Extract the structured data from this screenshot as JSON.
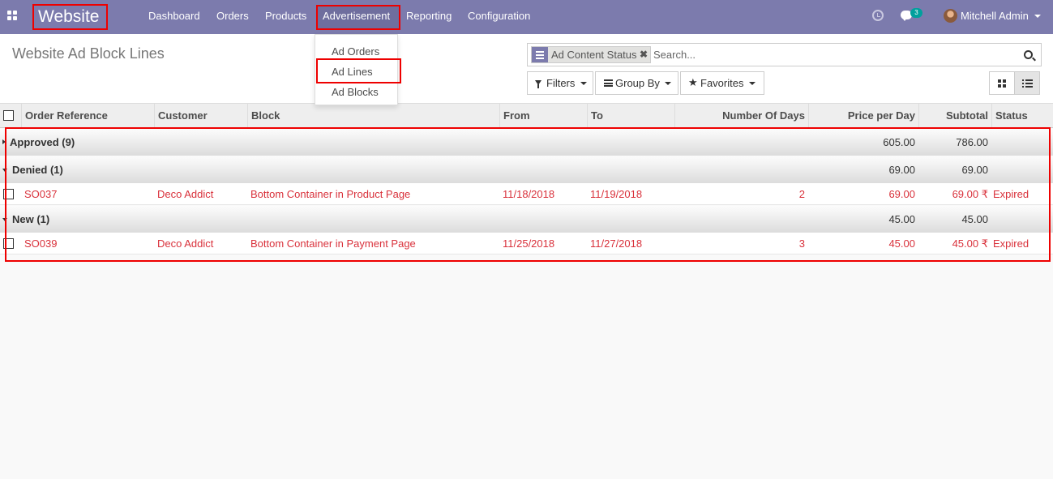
{
  "navbar": {
    "brand": "Website",
    "menu": [
      "Dashboard",
      "Orders",
      "Products",
      "Advertisement",
      "Reporting",
      "Configuration"
    ],
    "chat_count": "3",
    "user": "Mitchell Admin",
    "bg_color": "#7c7bad"
  },
  "advertisement_menu": {
    "items": [
      "Ad Orders",
      "Ad Lines",
      "Ad Blocks"
    ],
    "highlighted": "Ad Lines"
  },
  "control_panel": {
    "title": "Website Ad Block Lines",
    "search": {
      "facet": "Ad Content Status",
      "placeholder": "Search..."
    },
    "buttons": {
      "filters": "Filters",
      "group_by": "Group By",
      "favorites": "Favorites"
    },
    "active_view": "list"
  },
  "table": {
    "columns": [
      "Order Reference",
      "Customer",
      "Block",
      "From",
      "To",
      "Number Of Days",
      "Price per Day",
      "Subtotal",
      "Status"
    ],
    "groups": [
      {
        "label": "Approved (9)",
        "expanded": false,
        "price_per_day": "605.00",
        "subtotal": "786.00",
        "rows": []
      },
      {
        "label": "Denied (1)",
        "expanded": true,
        "price_per_day": "69.00",
        "subtotal": "69.00",
        "rows": [
          {
            "order_ref": "SO037",
            "customer": "Deco Addict",
            "block": "Bottom Container in Product Page",
            "from": "11/18/2018",
            "to": "11/19/2018",
            "days": "2",
            "price_per_day": "69.00",
            "subtotal": "69.00 ₹",
            "status": "Expired"
          }
        ]
      },
      {
        "label": "New (1)",
        "expanded": true,
        "price_per_day": "45.00",
        "subtotal": "45.00",
        "rows": [
          {
            "order_ref": "SO039",
            "customer": "Deco Addict",
            "block": "Bottom Container in Payment Page",
            "from": "11/25/2018",
            "to": "11/27/2018",
            "days": "3",
            "price_per_day": "45.00",
            "subtotal": "45.00 ₹",
            "status": "Expired"
          }
        ]
      }
    ]
  },
  "colors": {
    "highlight_box": "#ee0000",
    "row_text": "#d9313b"
  }
}
